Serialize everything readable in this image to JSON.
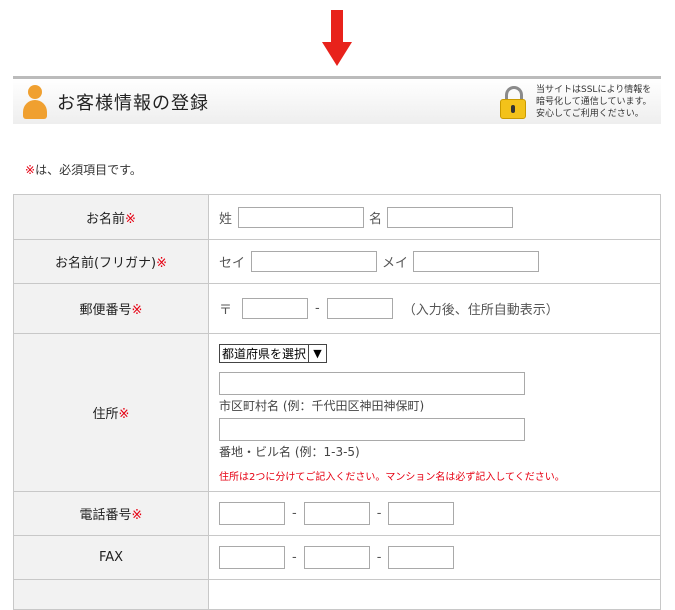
{
  "header": {
    "title": "お客様情報の登録",
    "ssl_note": [
      "当サイトはSSLにより情報を",
      "暗号化して通信しています。",
      "安心してご利用ください。"
    ]
  },
  "required_note": {
    "mark": "※",
    "text": "は、必須項目です。"
  },
  "required_mark": "※",
  "rows": {
    "name": {
      "label": "お名前",
      "sei_prefix": "姓",
      "mei_prefix": "名"
    },
    "furigana": {
      "label": "お名前(フリガナ)",
      "sei_prefix": "セイ",
      "mei_prefix": "メイ"
    },
    "postal": {
      "label": "郵便番号",
      "prefix": "〒",
      "separator": "-",
      "hint": "（入力後、住所自動表示）"
    },
    "address": {
      "label": "住所",
      "prefecture_selected": "都道府県を選択",
      "city_hint": "市区町村名 (例：千代田区神田神保町)",
      "street_hint": "番地・ビル名 (例：1-3-5)",
      "warning": "住所は2つに分けてご記入ください。マンション名は必ず記入してください。"
    },
    "phone": {
      "label": "電話番号",
      "separator": "-"
    },
    "fax": {
      "label": "FAX",
      "separator": "-"
    }
  },
  "colors": {
    "arrow": "#e8221b",
    "required": "#e60012",
    "label_bg": "#f2f2f2",
    "border": "#c8c8c8",
    "person_icon": "#f0a030",
    "lock_icon": "#f3c21a"
  },
  "icons": {
    "arrow": "down-arrow-icon",
    "person": "person-icon",
    "lock": "lock-icon",
    "select": "chevron-down-icon"
  }
}
